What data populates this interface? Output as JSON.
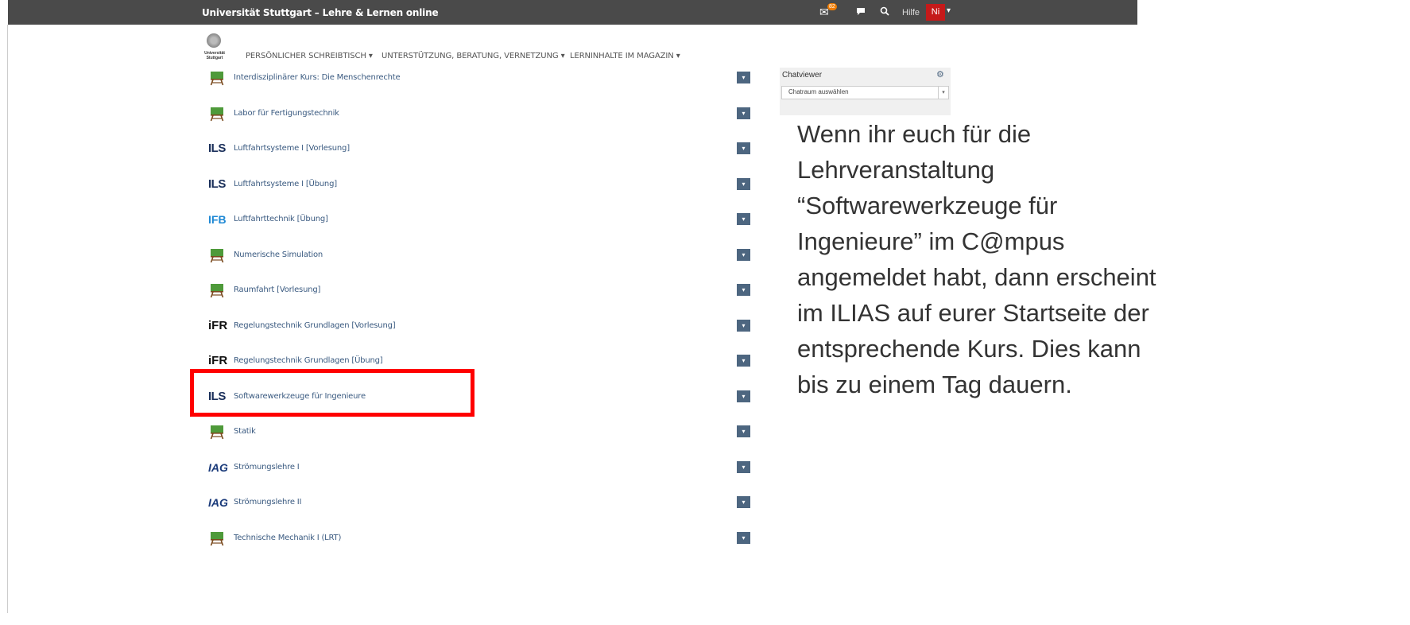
{
  "topbar": {
    "title": "Universität Stuttgart – Lehre & Lernen online",
    "mail_icon": "mail-icon",
    "mail_count": "82",
    "chat_icon": "chat-bubble-icon",
    "search_icon": "search-icon",
    "help_label": "Hilfe",
    "user_initials": "Ni",
    "bar_color": "#4a4a4a",
    "user_color": "#c51a1a"
  },
  "logo": {
    "text": "Universität Stuttgart"
  },
  "nav": [
    {
      "label": "PERSÖNLICHER SCHREIBTISCH"
    },
    {
      "label": "UNTERSTÜTZUNG, BERATUNG, VERNETZUNG"
    },
    {
      "label": "LERNINHALTE IM MAGAZIN"
    }
  ],
  "courses": [
    {
      "label": "Interdisziplinärer Kurs: Die Menschenrechte",
      "icon": "course-board-icon"
    },
    {
      "label": "Labor für Fertigungstechnik",
      "icon": "course-board-icon"
    },
    {
      "label": "Luftfahrtsysteme I [Vorlesung]",
      "icon": "ils-logo-icon",
      "logo": "ILS"
    },
    {
      "label": "Luftfahrtsysteme I [Übung]",
      "icon": "ils-logo-icon",
      "logo": "ILS"
    },
    {
      "label": "Luftfahrttechnik [Übung]",
      "icon": "ifb-logo-icon",
      "logo": "IFB"
    },
    {
      "label": "Numerische Simulation",
      "icon": "course-board-icon"
    },
    {
      "label": "Raumfahrt [Vorlesung]",
      "icon": "course-board-icon"
    },
    {
      "label": "Regelungstechnik Grundlagen [Vorlesung]",
      "icon": "ifr-logo-icon",
      "logo": "iFR"
    },
    {
      "label": "Regelungstechnik Grundlagen [Übung]",
      "icon": "ifr-logo-icon",
      "logo": "iFR"
    },
    {
      "label": "Softwarewerkzeuge für Ingenieure",
      "icon": "ils-logo-icon",
      "logo": "ILS",
      "highlighted": true
    },
    {
      "label": "Statik",
      "icon": "course-board-icon"
    },
    {
      "label": "Strömungslehre I",
      "icon": "iag-logo-icon",
      "logo": "IAG"
    },
    {
      "label": "Strömungslehre II",
      "icon": "iag-logo-icon",
      "logo": "IAG"
    },
    {
      "label": "Technische Mechanik I (LRT)",
      "icon": "course-board-icon"
    }
  ],
  "chatviewer": {
    "title": "Chatviewer",
    "select_value": "Chatraum auswählen",
    "gear_icon": "gear-icon"
  },
  "explanation": [
    "Wenn ihr euch für die",
    "Lehrveranstaltung",
    "“Softwarewerkzeuge für",
    "Ingenieure” im C@mpus",
    "angemeldet habt, dann erscheint",
    "im ILIAS auf eurer Startseite der",
    "entsprechende Kurs. Dies kann",
    "bis zu einem Tag dauern."
  ],
  "highlight_color": "#ff0000"
}
